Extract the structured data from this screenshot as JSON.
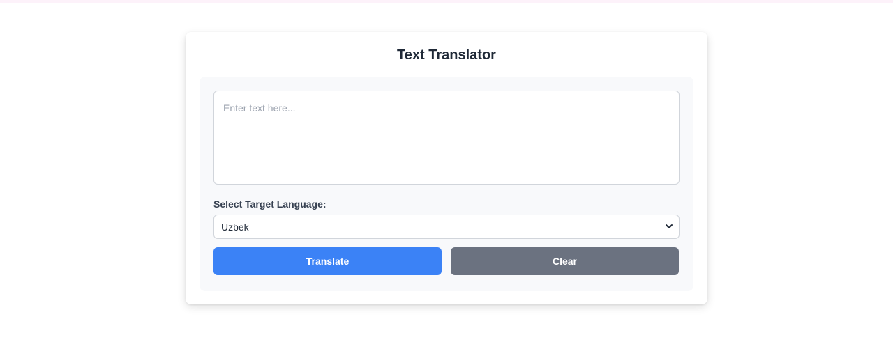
{
  "app": {
    "title": "Text Translator"
  },
  "input": {
    "value": "",
    "placeholder": "Enter text here..."
  },
  "language": {
    "label": "Select Target Language:",
    "selected": "Uzbek"
  },
  "buttons": {
    "translate_label": "Translate",
    "clear_label": "Clear"
  },
  "colors": {
    "primary": "#3b82f6",
    "secondary": "#6b7280",
    "panel_bg": "#f8f9fb"
  }
}
